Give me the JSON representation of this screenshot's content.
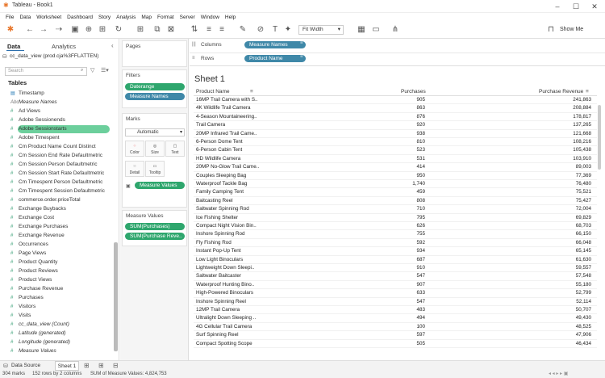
{
  "app": {
    "title": "Tableau - Book1"
  },
  "menu": [
    "File",
    "Data",
    "Worksheet",
    "Dashboard",
    "Story",
    "Analysis",
    "Map",
    "Format",
    "Server",
    "Window",
    "Help"
  ],
  "toolbar": {
    "fit": "Fit Width",
    "show_me": "Show Me"
  },
  "data_pane": {
    "tab_data": "Data",
    "tab_analytics": "Analytics",
    "datasource": "cc_data_view (prod.cja%3FFLATTEN)",
    "search_placeholder": "Search",
    "tables_header": "Tables",
    "fields": [
      {
        "label": "Timestamp",
        "kind": "date",
        "italic": false
      },
      {
        "label": "Measure Names",
        "kind": "abc",
        "italic": true
      },
      {
        "label": "Ad Views",
        "kind": "num",
        "italic": false
      },
      {
        "label": "Adobe Sessionends",
        "kind": "num",
        "italic": false
      },
      {
        "label": "Adobe Sessionstarts",
        "kind": "num",
        "italic": false
      },
      {
        "label": "Adobe Timespent",
        "kind": "num",
        "italic": false
      },
      {
        "label": "Cm Product Name Count Distinct",
        "kind": "num",
        "italic": false
      },
      {
        "label": "Cm Session End Rate Defaultmetric",
        "kind": "num",
        "italic": false
      },
      {
        "label": "Cm Session Person Defaultmetric",
        "kind": "num",
        "italic": false
      },
      {
        "label": "Cm Session Start Rate Defaultmetric",
        "kind": "num",
        "italic": false
      },
      {
        "label": "Cm Timespent Person Defaultmetric",
        "kind": "num",
        "italic": false
      },
      {
        "label": "Cm Timespent Session Defaultmetric",
        "kind": "num",
        "italic": false
      },
      {
        "label": "commerce.order.priceTotal",
        "kind": "num",
        "italic": false
      },
      {
        "label": "Exchange Buybacks",
        "kind": "num",
        "italic": false
      },
      {
        "label": "Exchange Cost",
        "kind": "num",
        "italic": false
      },
      {
        "label": "Exchange Purchases",
        "kind": "num",
        "italic": false
      },
      {
        "label": "Exchange Revenue",
        "kind": "num",
        "italic": false
      },
      {
        "label": "Occurrences",
        "kind": "num",
        "italic": false
      },
      {
        "label": "Page Views",
        "kind": "num",
        "italic": false
      },
      {
        "label": "Product Quantity",
        "kind": "num",
        "italic": false
      },
      {
        "label": "Product Reviews",
        "kind": "num",
        "italic": false
      },
      {
        "label": "Product Views",
        "kind": "num",
        "italic": false
      },
      {
        "label": "Purchase Revenue",
        "kind": "num",
        "italic": false
      },
      {
        "label": "Purchases",
        "kind": "num",
        "italic": false
      },
      {
        "label": "Visitors",
        "kind": "num",
        "italic": false
      },
      {
        "label": "Visits",
        "kind": "num",
        "italic": false
      },
      {
        "label": "cc_data_view (Count)",
        "kind": "num",
        "italic": true
      },
      {
        "label": "Latitude (generated)",
        "kind": "num",
        "italic": true
      },
      {
        "label": "Longitude (generated)",
        "kind": "num",
        "italic": true
      },
      {
        "label": "Measure Values",
        "kind": "num",
        "italic": true
      }
    ]
  },
  "cards": {
    "pages": "Pages",
    "filters": "Filters",
    "filter_pills": [
      "Daterange",
      "Measure Names"
    ],
    "marks": "Marks",
    "mark_type": "Automatic",
    "mark_buttons": [
      "Color",
      "Size",
      "Text",
      "Detail",
      "Tooltip"
    ],
    "marks_pill": "Measure Values",
    "measure_values": "Measure Values",
    "mv_pills": [
      "SUM(Purchases)",
      "SUM(Purchase Reve.."
    ]
  },
  "shelves": {
    "columns_label": "Columns",
    "columns_pill": "Measure Names",
    "rows_label": "Rows",
    "rows_pill": "Product Name"
  },
  "sheet": {
    "title": "Sheet 1",
    "col_product": "Product Name",
    "col_purchases": "Purchases",
    "col_revenue": "Purchase Revenue",
    "rows": [
      [
        "16MP Trail Camera with S..",
        "905",
        "241,863"
      ],
      [
        "4K Wildlife Trail Camera",
        "863",
        "208,884"
      ],
      [
        "4-Season Mountaineering..",
        "876",
        "178,817"
      ],
      [
        "Trail Camera",
        "920",
        "137,265"
      ],
      [
        "20MP Infrared Trail Came..",
        "938",
        "121,668"
      ],
      [
        "6-Person Dome Tent",
        "810",
        "108,216"
      ],
      [
        "6-Person Cabin Tent",
        "523",
        "105,438"
      ],
      [
        "HD Wildlife Camera",
        "531",
        "103,910"
      ],
      [
        "20MP No-Glow Trail Came..",
        "414",
        "89,003"
      ],
      [
        "Couples Sleeping Bag",
        "950",
        "77,369"
      ],
      [
        "Waterproof Tackle Bag",
        "1,740",
        "76,480"
      ],
      [
        "Family Camping Tent",
        "459",
        "75,521"
      ],
      [
        "Baitcasting Reel",
        "808",
        "75,427"
      ],
      [
        "Saltwater Spinning Rod",
        "710",
        "72,004"
      ],
      [
        "Ice Fishing Shelter",
        "795",
        "69,829"
      ],
      [
        "Compact Night Vision Bin..",
        "626",
        "68,703"
      ],
      [
        "Inshore Spinning Rod",
        "755",
        "66,150"
      ],
      [
        "Fly Fishing Rod",
        "592",
        "66,048"
      ],
      [
        "Instant Pop-Up Tent",
        "934",
        "65,145"
      ],
      [
        "Low Light Binoculars",
        "687",
        "61,630"
      ],
      [
        "Lightweight Down Sleepi..",
        "910",
        "59,557"
      ],
      [
        "Saltwater Baitcaster",
        "547",
        "57,548"
      ],
      [
        "Waterproof Hunting Bino..",
        "907",
        "55,180"
      ],
      [
        "High-Powered Binoculars",
        "633",
        "52,799"
      ],
      [
        "Inshore Spinning Reel",
        "547",
        "52,114"
      ],
      [
        "12MP Trail Camera",
        "483",
        "50,707"
      ],
      [
        "Ultralight Down Sleeping ..",
        "494",
        "49,430"
      ],
      [
        "4G Cellular Trail Camera",
        "100",
        "48,525"
      ],
      [
        "Surf Spinning Reel",
        "597",
        "47,906"
      ],
      [
        "Compact Spotting Scope",
        "505",
        "46,434"
      ]
    ]
  },
  "tabs": {
    "data_source": "Data Source",
    "sheet1": "Sheet 1"
  },
  "status": {
    "marks": "304 marks",
    "rows": "152 rows by 2 columns",
    "sum": "SUM of Measure Values: 4,824,753"
  }
}
